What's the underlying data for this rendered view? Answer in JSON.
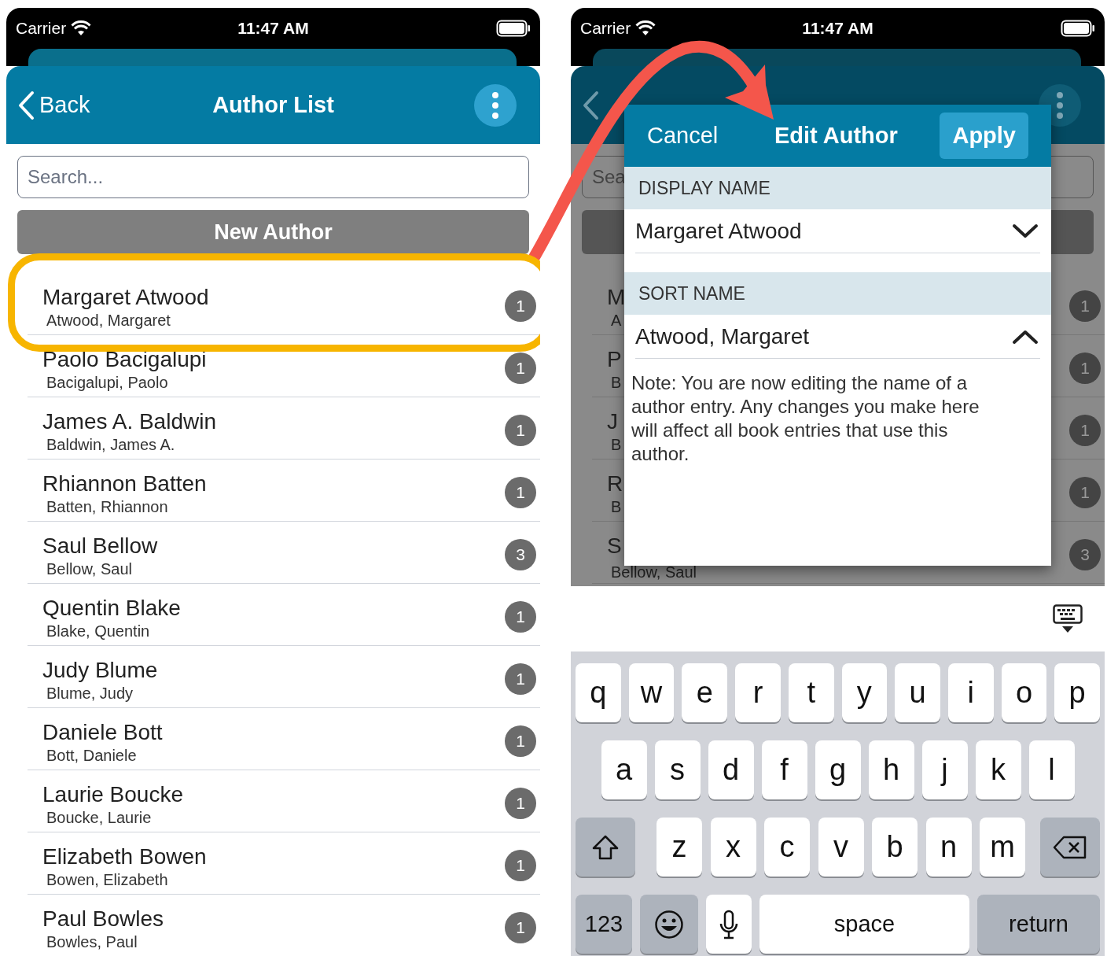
{
  "screens": [
    {
      "dimmed": false,
      "status_bar": {
        "carrier": "Carrier",
        "time": "11:47 AM"
      },
      "nav": {
        "back": "Back",
        "title": "Author List"
      },
      "search": {
        "placeholder": "Search..."
      },
      "new_button": "New Author",
      "authors": [
        {
          "name": "Margaret Atwood",
          "sort_name": "Atwood, Margaret",
          "count": "1",
          "highlighted": true
        },
        {
          "name": "Paolo Bacigalupi",
          "sort_name": "Bacigalupi, Paolo",
          "count": "1",
          "highlighted": false
        },
        {
          "name": "James A. Baldwin",
          "sort_name": "Baldwin, James A.",
          "count": "1",
          "highlighted": false
        },
        {
          "name": "Rhiannon Batten",
          "sort_name": "Batten, Rhiannon",
          "count": "1",
          "highlighted": false
        },
        {
          "name": "Saul Bellow",
          "sort_name": "Bellow, Saul",
          "count": "3",
          "highlighted": false
        },
        {
          "name": "Quentin Blake",
          "sort_name": "Blake, Quentin",
          "count": "1",
          "highlighted": false
        },
        {
          "name": "Judy Blume",
          "sort_name": "Blume, Judy",
          "count": "1",
          "highlighted": false
        },
        {
          "name": "Daniele Bott",
          "sort_name": "Bott, Daniele",
          "count": "1",
          "highlighted": false
        },
        {
          "name": "Laurie Boucke",
          "sort_name": "Boucke, Laurie",
          "count": "1",
          "highlighted": false
        },
        {
          "name": "Elizabeth Bowen",
          "sort_name": "Bowen, Elizabeth",
          "count": "1",
          "highlighted": false
        },
        {
          "name": "Paul Bowles",
          "sort_name": "Bowles, Paul",
          "count": "1",
          "highlighted": false
        }
      ]
    },
    {
      "dimmed": true,
      "status_bar": {
        "carrier": "Carrier",
        "time": "11:47 AM"
      },
      "search": {
        "placeholder": "Sea"
      },
      "authors": [
        {
          "name": "M",
          "sort_name": "A",
          "count": "1",
          "highlighted": false
        },
        {
          "name": "P",
          "sort_name": "B",
          "count": "1",
          "highlighted": false
        },
        {
          "name": "J",
          "sort_name": "B",
          "count": "1",
          "highlighted": false
        },
        {
          "name": "R",
          "sort_name": "B",
          "count": "1",
          "highlighted": false
        },
        {
          "name": "S",
          "sort_name": "Bellow, Saul",
          "count": "3",
          "highlighted": false
        }
      ],
      "dialog": {
        "cancel": "Cancel",
        "title": "Edit Author",
        "apply": "Apply",
        "fields": [
          {
            "section": "DISPLAY NAME",
            "value": "Margaret Atwood",
            "expanded": false
          },
          {
            "section": "SORT NAME",
            "value": "Atwood, Margaret",
            "expanded": true
          }
        ],
        "note": "Note: You are now editing the name of a author entry. Any changes you make here will affect all book entries that use this author."
      },
      "keyboard": {
        "rows": [
          {
            "keys": [
              {
                "kind": "letter",
                "label": "q"
              },
              {
                "kind": "letter",
                "label": "w"
              },
              {
                "kind": "letter",
                "label": "e"
              },
              {
                "kind": "letter",
                "label": "r"
              },
              {
                "kind": "letter",
                "label": "t"
              },
              {
                "kind": "letter",
                "label": "y"
              },
              {
                "kind": "letter",
                "label": "u"
              },
              {
                "kind": "letter",
                "label": "i"
              },
              {
                "kind": "letter",
                "label": "o"
              },
              {
                "kind": "letter",
                "label": "p"
              }
            ]
          },
          {
            "keys": [
              {
                "kind": "letter",
                "label": "a"
              },
              {
                "kind": "letter",
                "label": "s"
              },
              {
                "kind": "letter",
                "label": "d"
              },
              {
                "kind": "letter",
                "label": "f"
              },
              {
                "kind": "letter",
                "label": "g"
              },
              {
                "kind": "letter",
                "label": "h"
              },
              {
                "kind": "letter",
                "label": "j"
              },
              {
                "kind": "letter",
                "label": "k"
              },
              {
                "kind": "letter",
                "label": "l"
              }
            ]
          },
          {
            "keys": [
              {
                "kind": "shift"
              },
              {
                "kind": "letter",
                "label": "z"
              },
              {
                "kind": "letter",
                "label": "x"
              },
              {
                "kind": "letter",
                "label": "c"
              },
              {
                "kind": "letter",
                "label": "v"
              },
              {
                "kind": "letter",
                "label": "b"
              },
              {
                "kind": "letter",
                "label": "n"
              },
              {
                "kind": "letter",
                "label": "m"
              },
              {
                "kind": "delete"
              }
            ]
          },
          {
            "keys": [
              {
                "kind": "numbers",
                "label": "123"
              },
              {
                "kind": "emoji"
              },
              {
                "kind": "mic"
              },
              {
                "kind": "space",
                "label": "space"
              },
              {
                "kind": "return",
                "label": "return"
              }
            ]
          }
        ]
      }
    }
  ]
}
